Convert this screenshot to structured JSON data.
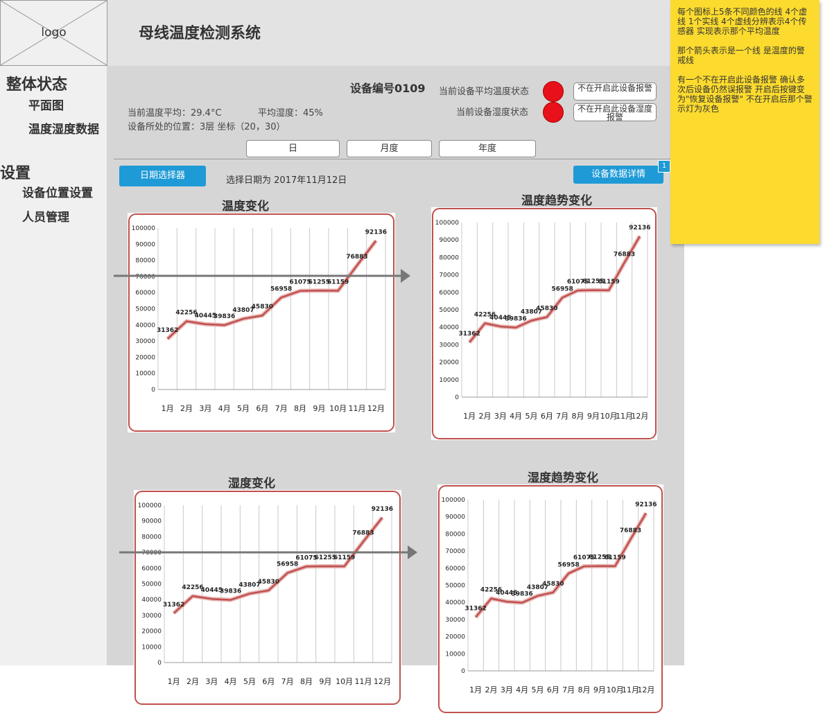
{
  "header": {
    "logo_text": "logo",
    "title": "母线温度检测系统"
  },
  "sidebar": {
    "section1": "整体状态",
    "items1": [
      "平面图",
      "温度湿度数据"
    ],
    "section2": "设置",
    "items2": [
      "设备位置设置",
      "人员管理"
    ]
  },
  "device": {
    "id_label": "设备编号0109",
    "avg_temp_text": "当前温度平均：29.4°C",
    "avg_humidity_text": "平均湿度：45%",
    "location_text": "设备所处的位置：3层  坐标（20，30）",
    "temp_status_label": "当前设备平均温度状态",
    "humidity_status_label": "当前设备湿度状态",
    "temp_alarm_button": "不在开启此设备报警",
    "humidity_alarm_button": "不在开启此设备湿度报警",
    "lamp_color": "#e8101a"
  },
  "tabs": [
    "日",
    "月度",
    "年度"
  ],
  "toolbar": {
    "date_picker": "日期选择器",
    "selected_date": "选择日期为 2017年11月12日",
    "details_button": "设备数据详情",
    "badge": "1"
  },
  "colors": {
    "accent": "#1e9ad6",
    "sticky": "#fcdb2e",
    "line": "#c0504d",
    "alarm": "#e8101a"
  },
  "chart_data": [
    {
      "type": "line",
      "title": "温度变化",
      "categories": [
        "1月",
        "2月",
        "3月",
        "4月",
        "5月",
        "6月",
        "7月",
        "8月",
        "9月",
        "10月",
        "11月",
        "12月"
      ],
      "values": [
        31362,
        42256,
        40445,
        39836,
        43807,
        45830,
        56958,
        61075,
        61255,
        61159,
        76883,
        92136
      ],
      "ylim": [
        0,
        100000
      ],
      "yticks": [
        0,
        10000,
        20000,
        30000,
        40000,
        50000,
        60000,
        70000,
        80000,
        90000,
        100000
      ],
      "grid": true
    },
    {
      "type": "line",
      "title": "温度趋势变化",
      "categories": [
        "1月",
        "2月",
        "3月",
        "4月",
        "5月",
        "6月",
        "7月",
        "8月",
        "9月",
        "10月",
        "11月",
        "12月"
      ],
      "values": [
        31362,
        42256,
        40445,
        39836,
        43807,
        45830,
        56958,
        61075,
        61255,
        61159,
        76883,
        92136
      ],
      "ylim": [
        0,
        100000
      ],
      "yticks": [
        0,
        10000,
        20000,
        30000,
        40000,
        50000,
        60000,
        70000,
        80000,
        90000,
        100000
      ],
      "grid": true
    },
    {
      "type": "line",
      "title": "湿度变化",
      "categories": [
        "1月",
        "2月",
        "3月",
        "4月",
        "5月",
        "6月",
        "7月",
        "8月",
        "9月",
        "10月",
        "11月",
        "12月"
      ],
      "values": [
        31362,
        42256,
        40445,
        39836,
        43807,
        45830,
        56958,
        61075,
        61255,
        61159,
        76883,
        92136
      ],
      "ylim": [
        0,
        100000
      ],
      "yticks": [
        0,
        10000,
        20000,
        30000,
        40000,
        50000,
        60000,
        70000,
        80000,
        90000,
        100000
      ],
      "grid": true
    },
    {
      "type": "line",
      "title": "湿度趋势变化",
      "categories": [
        "1月",
        "2月",
        "3月",
        "4月",
        "5月",
        "6月",
        "7月",
        "8月",
        "9月",
        "10月",
        "11月",
        "12月"
      ],
      "values": [
        31362,
        42256,
        40445,
        39836,
        43807,
        45830,
        56958,
        61075,
        61255,
        61159,
        76883,
        92136
      ],
      "ylim": [
        0,
        100000
      ],
      "yticks": [
        0,
        10000,
        20000,
        30000,
        40000,
        50000,
        60000,
        70000,
        80000,
        90000,
        100000
      ],
      "grid": true
    }
  ],
  "sticky_note": {
    "p1": "每个图标上5条不同颜色的线 4个虚线 1个实线 4个虚线分辨表示4个传感器 实现表示那个平均温度",
    "p2": "那个箭头表示是一个线 是温度的警戒线",
    "p3": "有一个不在开启此设备报警 确认多次后设备仍然误报警 开启后按键变为\"恢复设备报警\" 不在开启后那个警示灯为灰色"
  }
}
